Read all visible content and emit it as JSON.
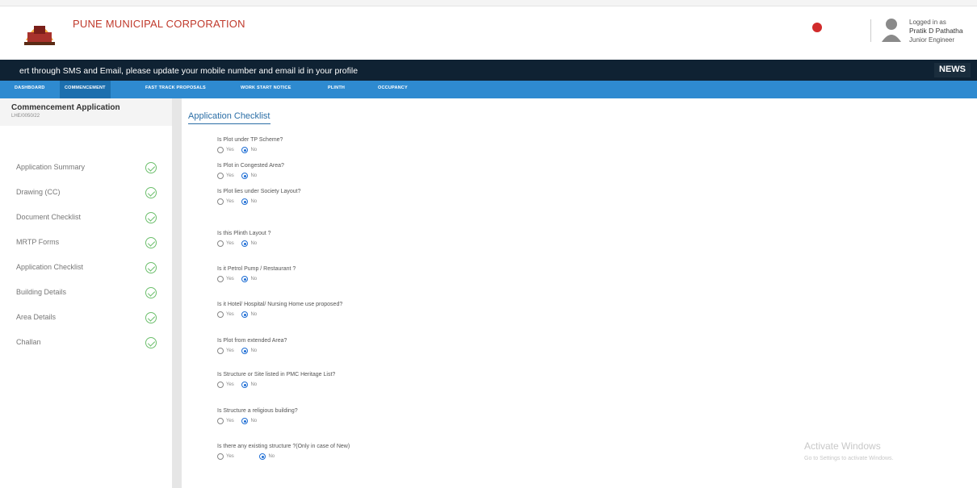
{
  "header": {
    "org_title": "PUNE MUNICIPAL CORPORATION",
    "logged_in_label": "Logged in as",
    "user_name": "Pratik D Pathatha",
    "user_role": "Junior Engineer"
  },
  "ticker": {
    "text": "ert through SMS and Email, please update your mobile number and email id in your profile",
    "news_label": "NEWS"
  },
  "nav": {
    "items": [
      "DASHBOARD",
      "COMMENCEMENT",
      "FAST TRACK PROPOSALS",
      "WORK START NOTICE",
      "PLINTH",
      "OCCUPANCY"
    ]
  },
  "sidebar": {
    "title": "Commencement Application",
    "subtitle": "LHE/0050/22",
    "items": [
      "Application Summary",
      "Drawing (CC)",
      "Document Checklist",
      "MRTP Forms",
      "Application Checklist",
      "Building Details",
      "Area Details",
      "Challan"
    ]
  },
  "checklist": {
    "title": "Application Checklist",
    "yes_label": "Yes",
    "no_label": "No",
    "questions": [
      {
        "text": "Is Plot under TP Scheme?",
        "selected": "No"
      },
      {
        "text": "Is Plot in Congested Area?",
        "selected": "No"
      },
      {
        "text": "Is Plot lies under Society Layout?",
        "selected": "No"
      },
      {
        "text": "Is this Plinth Layout ?",
        "selected": "No"
      },
      {
        "text": "Is it Petrol Pump / Restaurant ?",
        "selected": "No"
      },
      {
        "text": "Is it Hotel/ Hospital/ Nursing Home use proposed?",
        "selected": "No"
      },
      {
        "text": "Is Plot from extended Area?",
        "selected": "No"
      },
      {
        "text": "Is Structure or Site listed in PMC Heritage List?",
        "selected": "No"
      },
      {
        "text": "Is Structure a religious building?",
        "selected": "No"
      },
      {
        "text": "Is there any existing structure ?(Only in case of New)",
        "selected": "No"
      }
    ]
  },
  "watermark": {
    "title": "Activate Windows",
    "subtitle": "Go to Settings to activate Windows."
  },
  "colors": {
    "nav_blue": "#2e8ad0",
    "ticker_dark": "#0f2233",
    "accent_red": "#c0392b",
    "check_green": "#6cbf6c"
  }
}
